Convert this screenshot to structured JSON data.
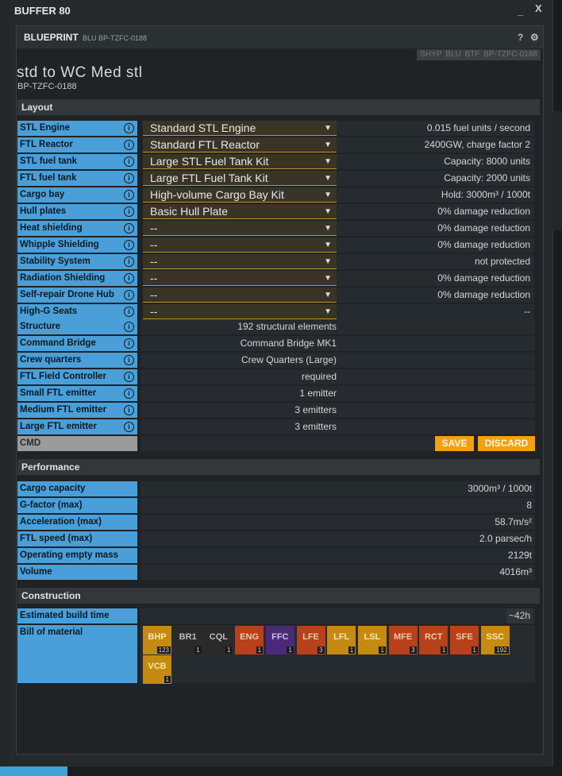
{
  "window": {
    "title": "BUFFER 80",
    "minimize": "_",
    "close": "X"
  },
  "panel": {
    "title": "BLUEPRINT",
    "subtitle": "BLU BP-TZFC-0188",
    "help": "?",
    "tags": [
      "SHYP",
      "BLU",
      "BTF"
    ],
    "tag_id": "BP-TZFC-0188"
  },
  "blueprint": {
    "name": "std to WC Med stl",
    "id": "BP-TZFC-0188"
  },
  "sections": {
    "layout": "Layout",
    "performance": "Performance",
    "construction": "Construction"
  },
  "layout_rows": [
    {
      "label": "STL Engine",
      "select": "Standard STL Engine",
      "value": "0.015 fuel units / second"
    },
    {
      "label": "FTL Reactor",
      "select": "Standard FTL Reactor",
      "value": "2400GW, charge factor 2"
    },
    {
      "label": "STL fuel tank",
      "select": "Large STL Fuel Tank Kit",
      "value": "Capacity: 8000 units"
    },
    {
      "label": "FTL fuel tank",
      "select": "Large FTL Fuel Tank Kit",
      "value": "Capacity: 2000 units"
    },
    {
      "label": "Cargo bay",
      "select": "High-volume Cargo Bay Kit",
      "value": "Hold: 3000m³ / 1000t"
    },
    {
      "label": "Hull plates",
      "select": "Basic Hull Plate",
      "value": "0% damage reduction"
    },
    {
      "label": "Heat shielding",
      "select": "--",
      "value": "0% damage reduction"
    },
    {
      "label": "Whipple Shielding",
      "select": "--",
      "value": "0% damage reduction"
    },
    {
      "label": "Stability System",
      "select": "--",
      "value": "not protected"
    },
    {
      "label": "Radiation Shielding",
      "select": "--",
      "value": "0% damage reduction"
    },
    {
      "label": "Self-repair Drone Hub",
      "select": "--",
      "value": "0% damage reduction"
    },
    {
      "label": "High-G Seats",
      "select": "--",
      "value": "--"
    }
  ],
  "fixed_rows": [
    {
      "label": "Structure",
      "value": "192 structural elements"
    },
    {
      "label": "Command Bridge",
      "value": "Command Bridge MK1"
    },
    {
      "label": "Crew quarters",
      "value": "Crew Quarters (Large)"
    },
    {
      "label": "FTL Field Controller",
      "value": "required"
    },
    {
      "label": "Small FTL emitter",
      "value": "1 emitter"
    },
    {
      "label": "Medium FTL emitter",
      "value": "3 emitters"
    },
    {
      "label": "Large FTL emitter",
      "value": "3 emitters"
    }
  ],
  "cmd": {
    "label": "CMD",
    "save": "SAVE",
    "discard": "DISCARD"
  },
  "performance_rows": [
    {
      "label": "Cargo capacity",
      "value": "3000m³ / 1000t"
    },
    {
      "label": "G-factor (max)",
      "value": "8"
    },
    {
      "label": "Acceleration (max)",
      "value": "58.7m/s²"
    },
    {
      "label": "FTL speed (max)",
      "value": "2.0 parsec/h"
    },
    {
      "label": "Operating empty mass",
      "value": "2129t"
    },
    {
      "label": "Volume",
      "value": "4016m³"
    }
  ],
  "construction": {
    "build_time_label": "Estimated build time",
    "build_time": "~42h",
    "bom_label": "Bill of material"
  },
  "materials": [
    {
      "ticker": "BHP",
      "count": "123",
      "bg": "#c58a10",
      "fg": "#f5e6b0"
    },
    {
      "ticker": "BR1",
      "count": "1",
      "bg": "#2a2a2a",
      "fg": "#bbbbbb"
    },
    {
      "ticker": "CQL",
      "count": "1",
      "bg": "#2a2a2a",
      "fg": "#bbbbbb"
    },
    {
      "ticker": "ENG",
      "count": "1",
      "bg": "#b8401a",
      "fg": "#f2c8a8"
    },
    {
      "ticker": "FFC",
      "count": "1",
      "bg": "#4a2a78",
      "fg": "#cfc0ec"
    },
    {
      "ticker": "LFE",
      "count": "3",
      "bg": "#b8401a",
      "fg": "#f2c8a8"
    },
    {
      "ticker": "LFL",
      "count": "1",
      "bg": "#c58a10",
      "fg": "#f5e6b0"
    },
    {
      "ticker": "LSL",
      "count": "1",
      "bg": "#c58a10",
      "fg": "#f5e6b0"
    },
    {
      "ticker": "MFE",
      "count": "3",
      "bg": "#b8401a",
      "fg": "#f2c8a8"
    },
    {
      "ticker": "RCT",
      "count": "1",
      "bg": "#b8401a",
      "fg": "#f2c8a8"
    },
    {
      "ticker": "SFE",
      "count": "1",
      "bg": "#b8401a",
      "fg": "#f2c8a8"
    },
    {
      "ticker": "SSC",
      "count": "192",
      "bg": "#c58a10",
      "fg": "#f5e6b0"
    },
    {
      "ticker": "VCB",
      "count": "1",
      "bg": "#c58a10",
      "fg": "#f5e6b0"
    }
  ]
}
